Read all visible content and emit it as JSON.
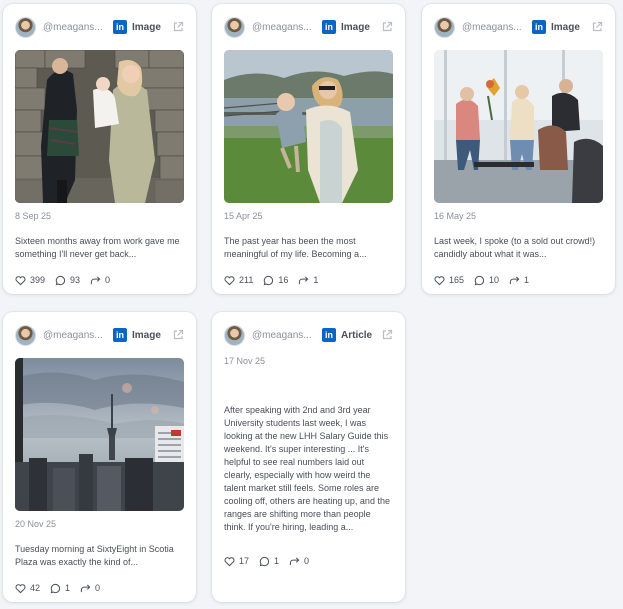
{
  "posts": [
    {
      "handle": "@meagans...",
      "type": "Image",
      "date": "8 Sep 25",
      "caption": "Sixteen months away from work gave me something I'll never get back...",
      "likes": "399",
      "comments": "93",
      "shares": "0"
    },
    {
      "handle": "@meagans...",
      "type": "Image",
      "date": "15 Apr 25",
      "caption": "The past year has been the most meaningful of my life. Becoming a...",
      "likes": "211",
      "comments": "16",
      "shares": "1"
    },
    {
      "handle": "@meagans...",
      "type": "Image",
      "date": "16 May 25",
      "caption": "Last week, I spoke (to a sold out crowd!) candidly about what it was...",
      "likes": "165",
      "comments": "10",
      "shares": "1"
    },
    {
      "handle": "@meagans...",
      "type": "Image",
      "date": "20 Nov 25",
      "caption": "Tuesday morning at SixtyEight in Scotia Plaza was exactly the kind of...",
      "likes": "42",
      "comments": "1",
      "shares": "0"
    },
    {
      "handle": "@meagans...",
      "type": "Article",
      "date": "17 Nov 25",
      "caption": "After speaking with 2nd and 3rd year University students last week, I was looking at the new LHH Salary Guide this weekend. It's super interesting ... It's helpful to see real numbers laid out clearly, especially with how weird the talent market still feels. Some roles are cooling off, others are heating up, and the ranges are shifting more than people think. If you're hiring, leading a...",
      "likes": "17",
      "comments": "1",
      "shares": "0"
    }
  ],
  "icons": {
    "network_logo": "in",
    "external_link": "external-link-icon",
    "like": "heart-icon",
    "comment": "comment-icon",
    "share": "share-icon"
  },
  "colors": {
    "linkedin_blue": "#0a66c2",
    "page_bg": "#f3f4f7"
  }
}
